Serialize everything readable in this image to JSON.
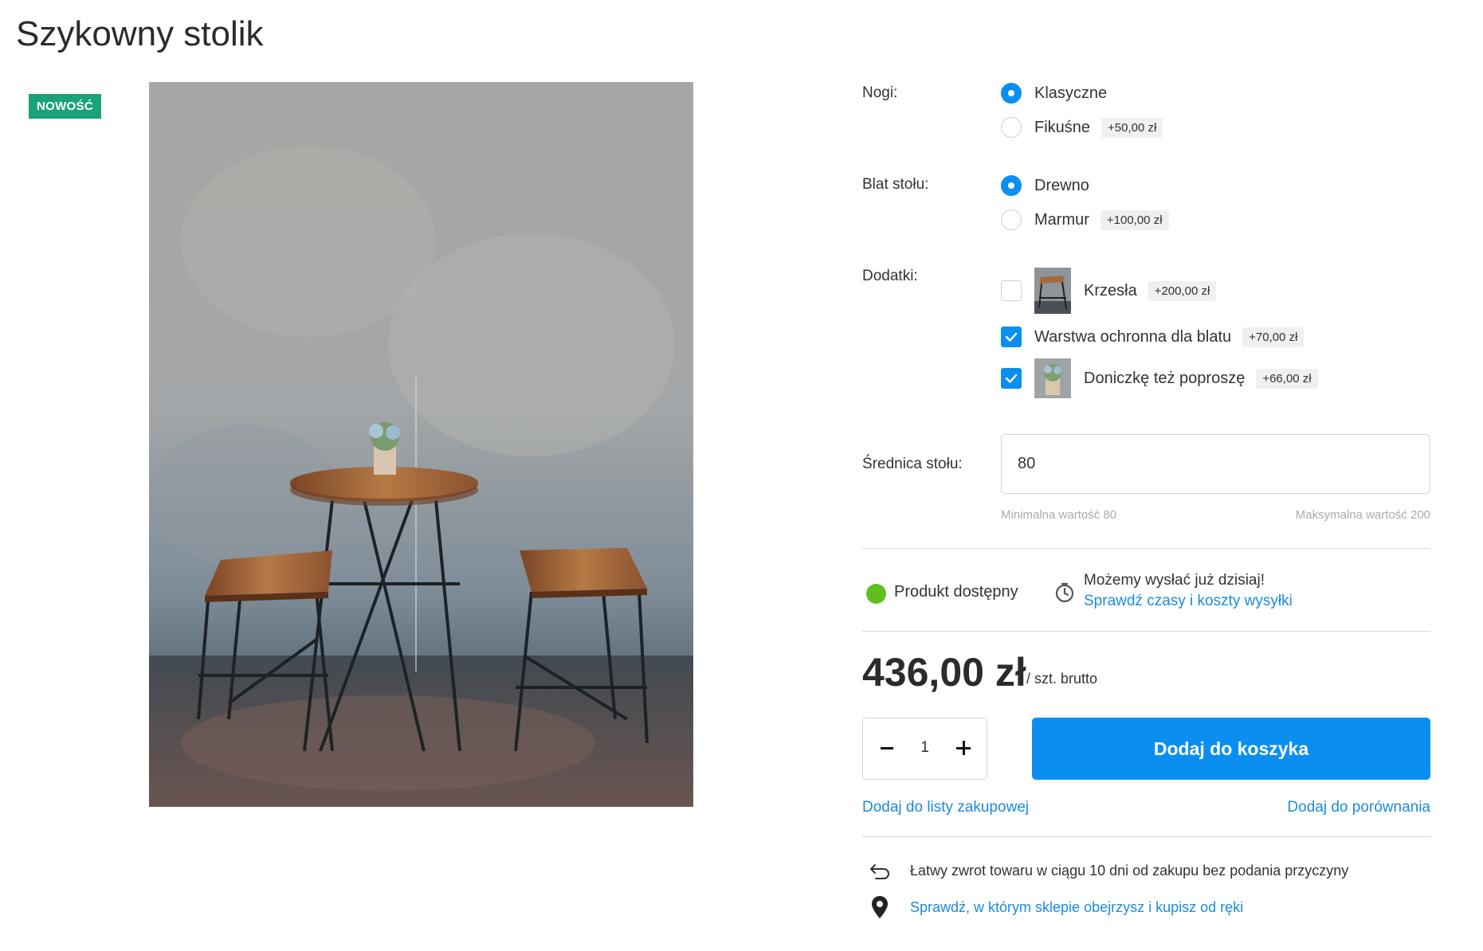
{
  "product": {
    "title": "Szykowny stolik",
    "badge": "NOWOŚĆ"
  },
  "options": {
    "legs": {
      "label": "Nogi:",
      "choices": [
        {
          "text": "Klasyczne",
          "selected": true,
          "price": ""
        },
        {
          "text": "Fikuśne",
          "selected": false,
          "price": "+50,00 zł"
        }
      ]
    },
    "top": {
      "label": "Blat stołu:",
      "choices": [
        {
          "text": "Drewno",
          "selected": true,
          "price": ""
        },
        {
          "text": "Marmur",
          "selected": false,
          "price": "+100,00 zł"
        }
      ]
    },
    "addons": {
      "label": "Dodatki:",
      "items": [
        {
          "text": "Krzesła",
          "checked": false,
          "price": "+200,00 zł"
        },
        {
          "text": "Warstwa ochronna dla blatu",
          "checked": true,
          "price": "+70,00 zł"
        },
        {
          "text": "Doniczkę też poproszę",
          "checked": true,
          "price": "+66,00 zł"
        }
      ]
    },
    "diameter": {
      "label": "Średnica stołu:",
      "value": "80",
      "hint_min": "Minimalna wartość 80",
      "hint_max": "Maksymalna wartość 200"
    }
  },
  "availability": {
    "status": "Produkt dostępny",
    "shipping": "Możemy wysłać już dzisiaj!",
    "shipping_link": "Sprawdź czasy i koszty wysyłki"
  },
  "price": {
    "value": "436,00 zł",
    "unit": "/ szt. brutto"
  },
  "cart": {
    "quantity": "1",
    "button": "Dodaj do koszyka",
    "wishlist_link": "Dodaj do listy zakupowej",
    "compare_link": "Dodaj do porównania"
  },
  "info": {
    "returns": "Łatwy zwrot towaru w ciągu 10 dni od zakupu bez podania przyczyny",
    "store_link": "Sprawdź, w którym sklepie obejrzysz i kupisz od ręki"
  },
  "colors": {
    "accent": "#0a8ff0",
    "badge": "#1aa37a",
    "available": "#5fbf1f"
  },
  "icons": [
    "check-icon",
    "stopwatch-icon",
    "return-arrow-icon",
    "map-pin-icon",
    "minus-icon",
    "plus-icon"
  ]
}
